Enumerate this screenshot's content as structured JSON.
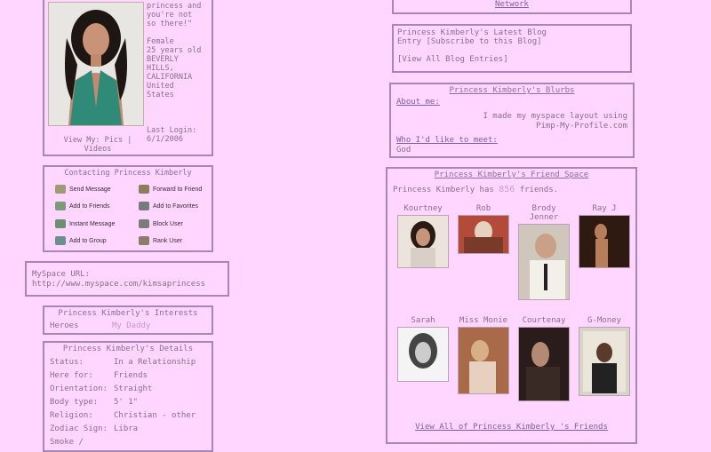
{
  "profile": {
    "info": "princess and\nyou're not\nso there!\"\n\nFemale\n25 years old\nBEVERLY\nHILLS,\nCALIFORNIA\nUnited\nStates\n\n\n\nLast Login:\n6/1/2006",
    "view_my": "View My: Pics | Videos"
  },
  "contact": {
    "title": "Contacting Princess Kimberly",
    "items": [
      {
        "label": "Send Message",
        "icon": "envelope-icon"
      },
      {
        "label": "Forward to Friend",
        "icon": "forward-icon"
      },
      {
        "label": "Add to Friends",
        "icon": "add-friend-icon"
      },
      {
        "label": "Add to Favorites",
        "icon": "favorite-icon"
      },
      {
        "label": "Instant Message",
        "icon": "instant-message-icon"
      },
      {
        "label": "Block User",
        "icon": "block-icon"
      },
      {
        "label": "Add to Group",
        "icon": "group-icon"
      },
      {
        "label": "Rank User",
        "icon": "rank-icon"
      }
    ]
  },
  "url": {
    "label": "MySpace URL:",
    "value": "http://www.myspace.com/kimsaprincess"
  },
  "interests": {
    "title": "Princess Kimberly's Interests",
    "heroes_label": "Heroes",
    "heroes_value": "My Daddy"
  },
  "details": {
    "title": "Princess Kimberly's Details",
    "rows": [
      {
        "label": "Status:",
        "value": "In a Relationship"
      },
      {
        "label": "Here for:",
        "value": "Friends"
      },
      {
        "label": "Orientation:",
        "value": "Straight"
      },
      {
        "label": "Body type:",
        "value": "5' 1\""
      },
      {
        "label": "Religion:",
        "value": "Christian - other"
      },
      {
        "label": "Zodiac Sign:",
        "value": "Libra"
      },
      {
        "label": "Smoke /",
        "value": ""
      }
    ]
  },
  "network": {
    "label": "Network"
  },
  "blog": {
    "title": "Princess Kimberly's Latest Blog Entry [Subscribe to this Blog]",
    "view_all": "[View All Blog Entries]"
  },
  "blurbs": {
    "title": "Princess Kimberly's Blurbs",
    "about_label": "About me:",
    "about_text": "I made my myspace layout using Pimp-My-Profile.com",
    "meet_label": "Who I'd like to meet:",
    "meet_text": "God"
  },
  "friends": {
    "title": "Princess Kimberly's Friend Space",
    "count_prefix": "Princess Kimberly has",
    "count": "856",
    "count_suffix": "friends.",
    "list": [
      {
        "name": "Kourtney"
      },
      {
        "name": "Rob"
      },
      {
        "name": "Brody Jenner"
      },
      {
        "name": "Ray J"
      },
      {
        "name": "Sarah"
      },
      {
        "name": "Miss Monie"
      },
      {
        "name": "Courtenay"
      },
      {
        "name": "G-Money"
      }
    ],
    "view_all": "View All of Princess Kimberly 's Friends"
  },
  "colors": {
    "background": "#ffd6ff",
    "border": "#a886b8",
    "link": "#7c5fa8"
  }
}
